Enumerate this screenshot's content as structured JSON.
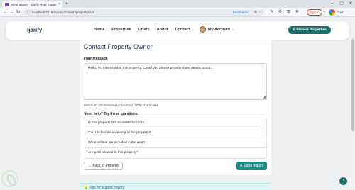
{
  "browser": {
    "tab_title": "Send Inquiry - Ijarify Real Estate",
    "tab_close": "×",
    "new_tab": "+",
    "url": "localhost:5115/Inquiry/Create?propertyId=b",
    "summarize": "Summarize",
    "sign_in": "Sign in",
    "chat": "Chat"
  },
  "site": {
    "logo": "Ijarify",
    "nav": [
      "Home",
      "Properties",
      "Offers",
      "About",
      "Contact"
    ],
    "account": "My Account",
    "browse_button": "Browse Properties"
  },
  "form": {
    "title": "Contact Property Owner",
    "message_label": "Your Message",
    "message_value": "Hello, I'm interested in this property. Could you please provide more details about...",
    "hint": "Minimum 10 characters, maximum 1000 characters",
    "help_label": "Need help? Try these questions:",
    "questions": [
      "Is this property still available for rent?",
      "Can I schedule a viewing of the property?",
      "What utilities are included in the rent?",
      "Are pets allowed in this property?"
    ],
    "back_button": "Back to Property",
    "send_button": "Send Inquiry"
  },
  "tips": "Tips for a good inquiry:",
  "colors": {
    "primary": "#1b6f6a",
    "send": "#1b8c80",
    "heading": "#1f3a5f",
    "tips_bg": "#dff6f9"
  }
}
